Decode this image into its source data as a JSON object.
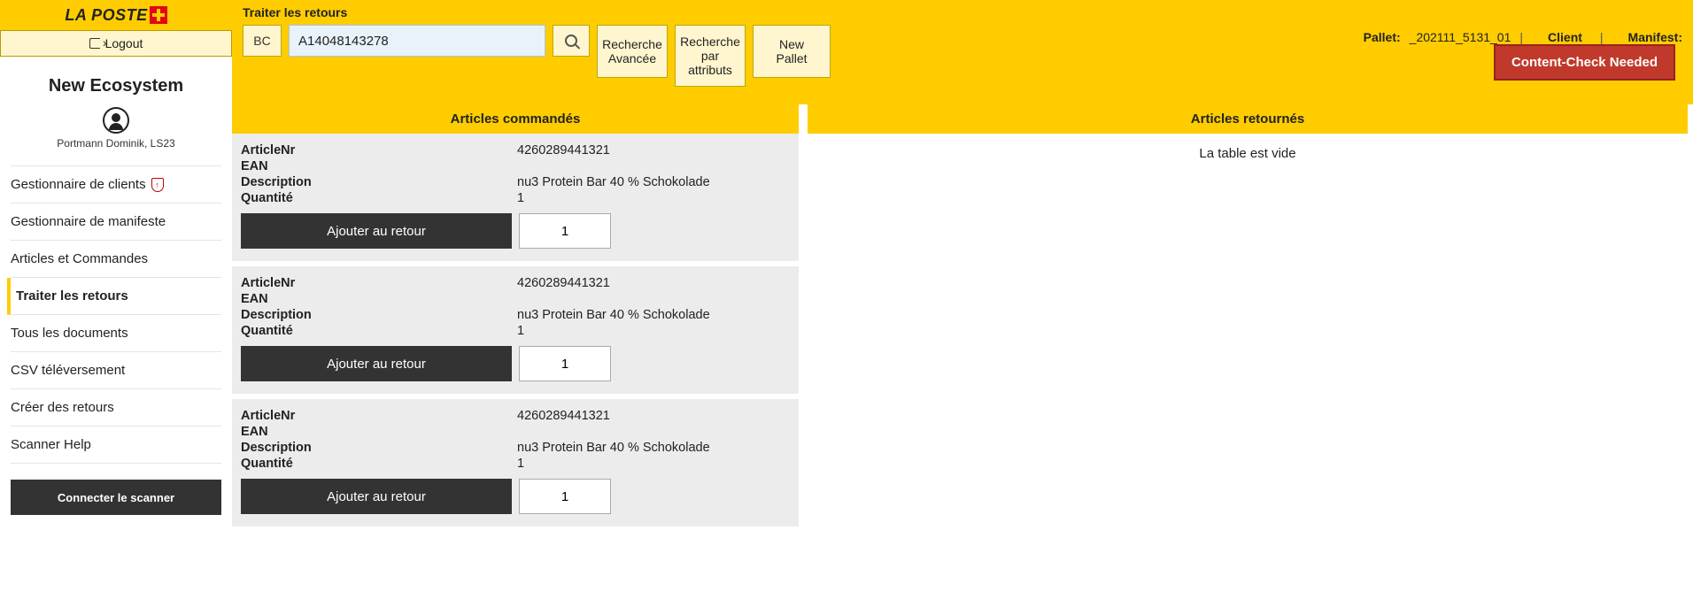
{
  "brand": {
    "name": "LA POSTE"
  },
  "logout": "Logout",
  "company": "New Ecosystem",
  "user": "Portmann Dominik, LS23",
  "nav": [
    {
      "label": "Gestionnaire de clients",
      "shield": true,
      "active": false
    },
    {
      "label": "Gestionnaire de manifeste",
      "active": false
    },
    {
      "label": "Articles et Commandes",
      "active": false
    },
    {
      "label": "Traiter les retours",
      "active": true
    },
    {
      "label": "Tous les documents",
      "active": false
    },
    {
      "label": "CSV téléversement",
      "active": false
    },
    {
      "label": "Créer des retours",
      "active": false
    },
    {
      "label": "Scanner Help",
      "active": false
    }
  ],
  "scanner_btn": "Connecter le scanner",
  "page_title": "Traiter les retours",
  "bc_label": "BC",
  "search_value": "A14048143278",
  "adv_search": "Recherche\nAvancée",
  "attr_search": "Recherche\npar\nattributs",
  "new_pallet": "New Pallet",
  "meta": {
    "pallet_label": "Pallet:",
    "pallet_value": "_202111_5131_01",
    "client_label": "Client",
    "manifest_label": "Manifest:"
  },
  "content_check": "Content-Check Needed",
  "cols": {
    "ordered": "Articles commandés",
    "returned": "Articles retournés"
  },
  "labels": {
    "articleNr": "ArticleNr",
    "ean": "EAN",
    "description": "Description",
    "quantity": "Quantité",
    "add": "Ajouter au retour"
  },
  "articles": [
    {
      "articleNr": "4260289441321",
      "ean": "",
      "description": "nu3 Protein Bar 40 % Schokolade",
      "quantity": "1",
      "input_qty": "1"
    },
    {
      "articleNr": "4260289441321",
      "ean": "",
      "description": "nu3 Protein Bar 40 % Schokolade",
      "quantity": "1",
      "input_qty": "1"
    },
    {
      "articleNr": "4260289441321",
      "ean": "",
      "description": "nu3 Protein Bar 40 % Schokolade",
      "quantity": "1",
      "input_qty": "1"
    }
  ],
  "returned_empty": "La table est vide"
}
